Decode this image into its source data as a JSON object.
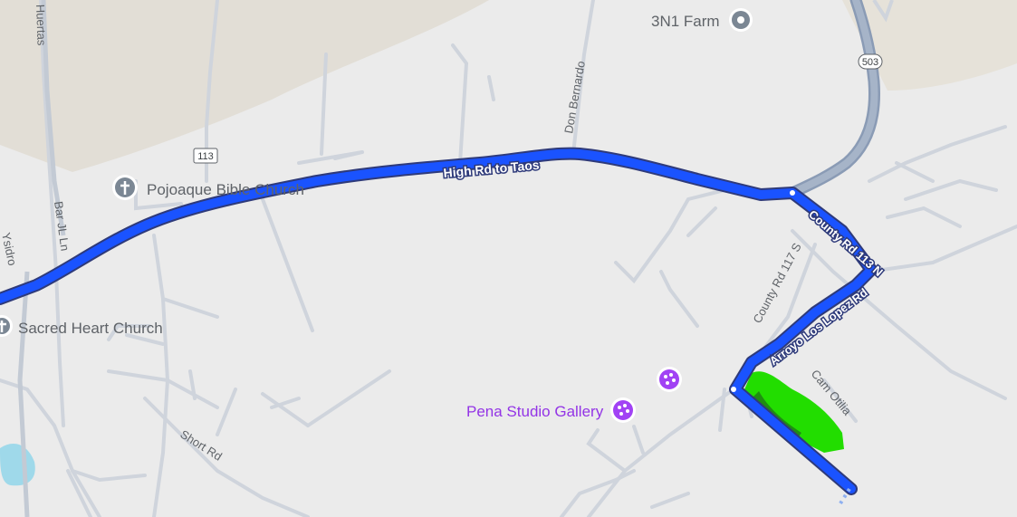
{
  "map": {
    "route": {
      "main_road": "High Rd to Taos",
      "segment_1": "County Rd 113 N",
      "segment_2": "Arroyo Los Lopez Rd",
      "route_color": "#1a53ff",
      "destination_highlight_color": "#22dd00"
    },
    "roads": {
      "huertas": "Huertas",
      "bar_jl_ln": "Bar JL Ln",
      "ysidro": "Ysidro",
      "don_bernardo": "Don Bernardo",
      "county_rd_117_s": "County Rd 117 S",
      "cam_otilia": "Cam Otilia",
      "short_rd": "Short Rd"
    },
    "shields": {
      "nm_113": "113",
      "nm_503": "503"
    },
    "places": {
      "farm": {
        "name": "3N1 Farm",
        "icon": "place-pin-icon"
      },
      "bible_church": {
        "name": "Pojoaque Bible Church",
        "icon": "church-cross-icon"
      },
      "sacred_heart": {
        "name": "Sacred Heart Church",
        "icon": "church-cross-icon"
      },
      "gallery": {
        "name": "Pena Studio Gallery",
        "icon": "palette-icon",
        "color": "#9334e6"
      }
    }
  }
}
